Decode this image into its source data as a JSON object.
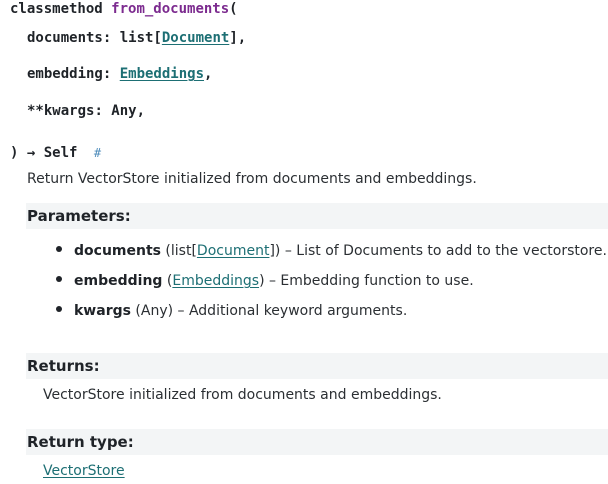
{
  "signature": {
    "keyword": "classmethod",
    "name": "from_documents",
    "open_paren": "(",
    "params": [
      {
        "name": "documents",
        "sep": ": ",
        "type_prefix": "list[",
        "type_link": "Document",
        "type_suffix": "],"
      },
      {
        "name": "embedding",
        "sep": ": ",
        "type_link": "Embeddings",
        "type_suffix": ","
      },
      {
        "name": "**kwargs",
        "sep": ": ",
        "type_plain": "Any",
        "type_suffix": ","
      }
    ],
    "close_paren": ")",
    "arrow": "→",
    "return_type": "Self",
    "headerlink": "#"
  },
  "description": "Return VectorStore initialized from documents and embeddings.",
  "parameters": {
    "title": "Parameters:",
    "items": [
      {
        "name": "documents",
        "type_prefix": " (list[",
        "type_link": "Document",
        "type_suffix": "])",
        "desc": " – List of Documents to add to the vectorstore."
      },
      {
        "name": "embedding",
        "type_prefix": " (",
        "type_link": "Embeddings",
        "type_suffix": ")",
        "desc": " – Embedding function to use."
      },
      {
        "name": "kwargs",
        "type_prefix": " (Any)",
        "type_link": "",
        "type_suffix": "",
        "desc": " – Additional keyword arguments."
      }
    ]
  },
  "returns": {
    "title": "Returns:",
    "text": "VectorStore initialized from documents and embeddings."
  },
  "return_type": {
    "title": "Return type:",
    "link": "VectorStore"
  }
}
